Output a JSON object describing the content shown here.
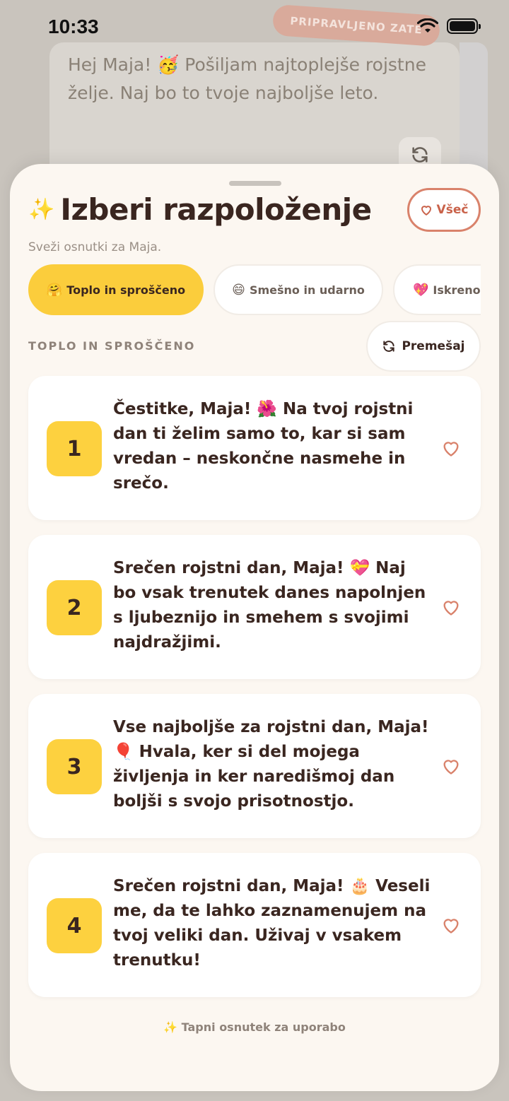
{
  "status": {
    "time": "10:33"
  },
  "background": {
    "badge": "PRIPRAVLJENO ZATE",
    "message": "Hej Maja! 🥳 Pošiljam najtoplejše rojstne želje. Naj bo to tvoje najboljše leto.",
    "refresh_icon": "refresh-icon"
  },
  "sheet": {
    "sparkle": "✨",
    "title": "Izberi razpoloženje",
    "favorites_label": "Všeč",
    "subtitle": "Sveži osnutki za Maja.",
    "chips": [
      {
        "emoji": "🤗",
        "label": "Toplo in sproščeno",
        "active": true
      },
      {
        "emoji": "😄",
        "label": "Smešno in udarno",
        "active": false
      },
      {
        "emoji": "💖",
        "label": "Iskreno",
        "active": false
      }
    ],
    "section_label": "TOPLO IN SPROŠČENO",
    "shuffle_label": "Premešaj",
    "drafts": [
      {
        "number": "1",
        "text": "Čestitke, Maja! 🌺 Na tvoj rojstni dan ti želim samo to, kar si sam vredan – neskončne nasmehe in srečo."
      },
      {
        "number": "2",
        "text": "Srečen rojstni dan, Maja! 💝 Naj bo vsak trenutek danes napolnjen s ljubeznijo in smehem s svojimi najdražjimi."
      },
      {
        "number": "3",
        "text": "Vse najboljše za rojstni dan, Maja! 🎈 Hvala, ker si del mojega življenja in ker naredišmoj dan boljši s svojo prisotnostjo."
      },
      {
        "number": "4",
        "text": "Srečen rojstni dan, Maja! 🎂 Veseli me, da te lahko zaznamenujem na tvoj veliki dan. Uživaj v vsakem trenutku!"
      }
    ],
    "footer_sparkle": "✨",
    "footer_hint": "Tapni osnutek za uporabo"
  },
  "colors": {
    "accent_yellow": "#fbcd3c",
    "heart": "#d9826b",
    "sheet_bg": "#fcf7f1"
  }
}
